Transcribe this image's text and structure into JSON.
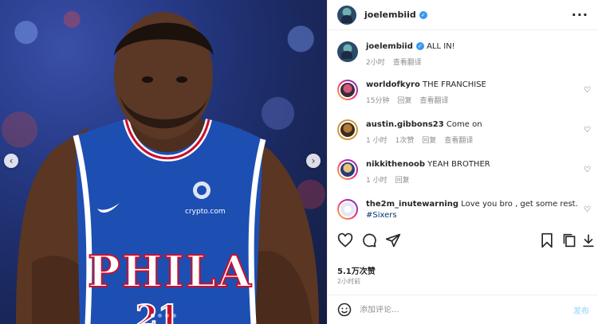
{
  "photo": {
    "jersey_text": "PHILA",
    "sponsor_text": "crypto.com",
    "number_text": "21",
    "prev_icon": "chevron-left-icon",
    "next_icon": "chevron-right-icon"
  },
  "post": {
    "owner": "joelembiid",
    "more_icon": "more-horizontal-icon",
    "caption": "ALL IN!",
    "caption_time": "2小时",
    "caption_translate": "查看翻译",
    "likes": "5.1万次赞",
    "time_ago": "2小时前"
  },
  "comments": [
    {
      "user": "worldofkyro",
      "text": "THE FRANCHISE",
      "time": "15分钟",
      "likes": "",
      "reply": "回复",
      "translate": "查看翻译"
    },
    {
      "user": "austin.gibbons23",
      "text": "Come on",
      "time": "1 小时",
      "likes": "1次赞",
      "reply": "回复",
      "translate": "查看翻译"
    },
    {
      "user": "nikkithenoob",
      "text": "YEAH BROTHER",
      "time": "1 小时",
      "likes": "",
      "reply": "回复",
      "translate": ""
    },
    {
      "user": "the2m_inutewarning",
      "text": "Love you bro , get some rest.",
      "hashtag": "#Sixers",
      "time": "",
      "likes": "",
      "reply": "",
      "translate": ""
    }
  ],
  "add_comment": {
    "placeholder": "添加评论...",
    "post_label": "发布",
    "emoji_icon": "smiley-icon"
  },
  "colors": {
    "verified": "#3897f0",
    "link": "#00376b",
    "muted": "#8e8e8e",
    "post_button": "#b2dffc",
    "jersey_blue": "#1d4fb3",
    "jersey_red": "#c8102e"
  }
}
